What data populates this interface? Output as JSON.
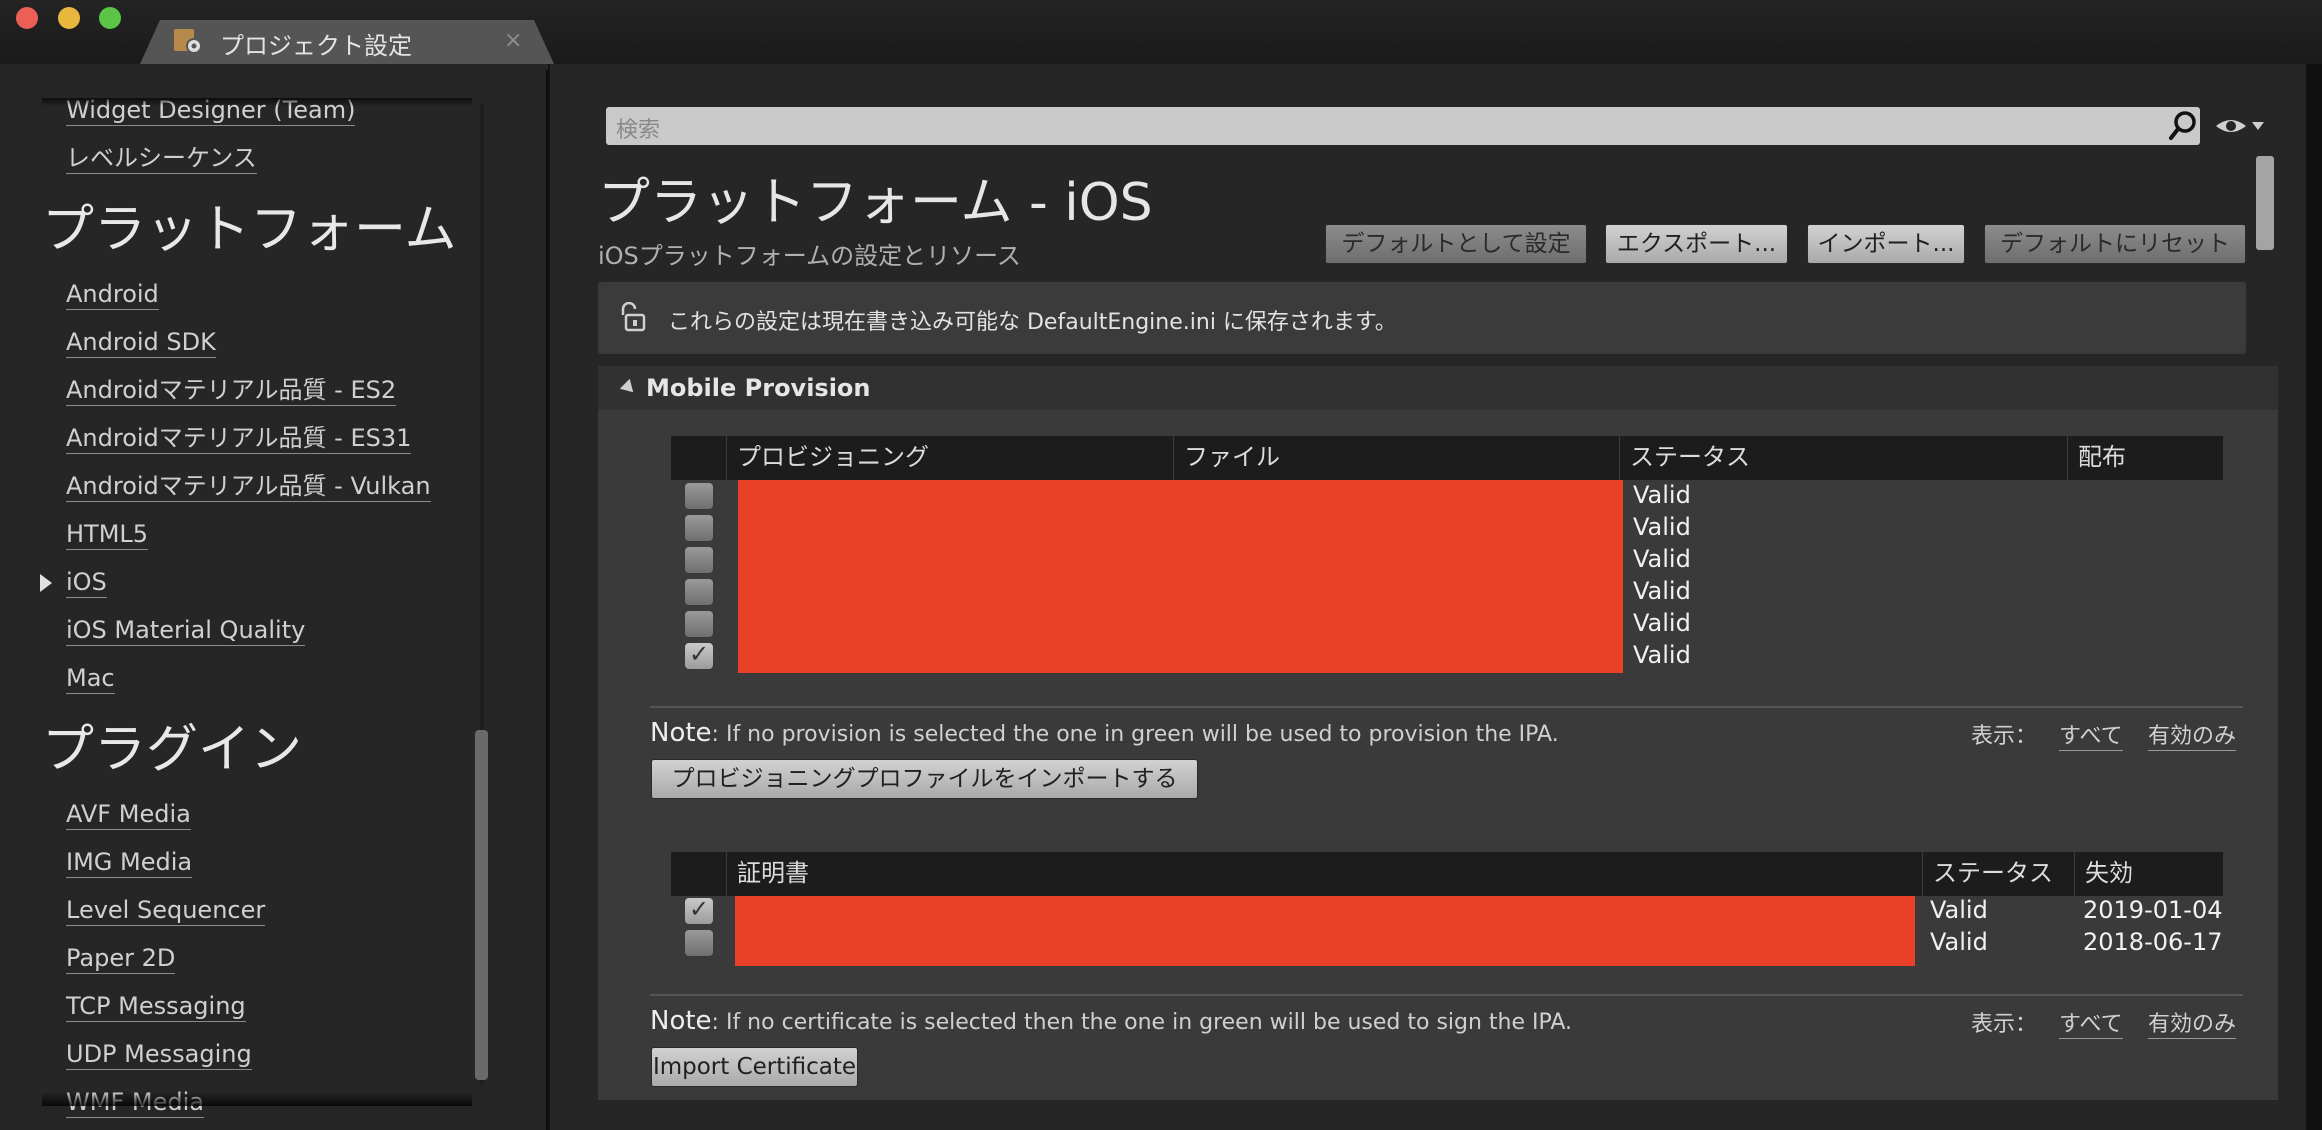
{
  "window": {
    "tab_title": "プロジェクト設定",
    "tab_close": "×"
  },
  "sidebar": {
    "items_top": [
      "Widget Designer (Team)",
      "レベルシーケンス"
    ],
    "platforms_heading": "プラットフォーム",
    "platforms": [
      "Android",
      "Android SDK",
      "Androidマテリアル品質 - ES2",
      "Androidマテリアル品質 - ES31",
      "Androidマテリアル品質 - Vulkan",
      "HTML5",
      "iOS",
      "iOS Material Quality",
      "Mac"
    ],
    "selected_platform": "iOS",
    "plugins_heading": "プラグイン",
    "plugins": [
      "AVF Media",
      "IMG Media",
      "Level Sequencer",
      "Paper 2D",
      "TCP Messaging",
      "UDP Messaging",
      "WMF Media"
    ]
  },
  "search": {
    "placeholder": "検索"
  },
  "page": {
    "title": "プラットフォーム - iOS",
    "subtitle": "iOSプラットフォームの設定とリソース"
  },
  "toolbar": {
    "set_default": "デフォルトとして設定",
    "export": "エクスポート...",
    "import": "インポート...",
    "reset_default": "デフォルトにリセット"
  },
  "info": {
    "text": "これらの設定は現在書き込み可能な DefaultEngine.ini に保存されます。"
  },
  "mobile_provision": {
    "section_title": "Mobile Provision",
    "provision_table": {
      "columns": [
        "プロビジョニング",
        "ファイル",
        "ステータス",
        "配布"
      ],
      "rows": [
        {
          "checked": false,
          "status": "Valid"
        },
        {
          "checked": false,
          "status": "Valid"
        },
        {
          "checked": false,
          "status": "Valid"
        },
        {
          "checked": false,
          "status": "Valid"
        },
        {
          "checked": false,
          "status": "Valid"
        },
        {
          "checked": true,
          "status": "Valid"
        }
      ]
    },
    "provision_note_label": "Note",
    "provision_note": ": If no provision is selected the one in green will be used to provision the IPA.",
    "show_label": "表示：",
    "show_all": "すべて",
    "show_valid": "有効のみ",
    "import_provision_button": "プロビジョニングプロファイルをインポートする",
    "cert_table": {
      "columns": [
        "証明書",
        "ステータス",
        "失効"
      ],
      "rows": [
        {
          "checked": true,
          "status": "Valid",
          "expires": "2019-01-04"
        },
        {
          "checked": false,
          "status": "Valid",
          "expires": "2018-06-17"
        }
      ]
    },
    "cert_note_label": "Note",
    "cert_note": ": If no certificate is selected then the one in green will be used to sign the IPA.",
    "import_cert_button": "Import Certificate"
  },
  "colors": {
    "redaction": "#e84127",
    "panel": "#262626",
    "section": "#3a3a3a"
  }
}
